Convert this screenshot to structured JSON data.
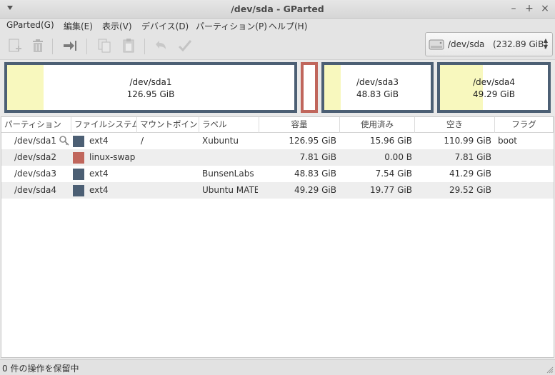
{
  "window": {
    "title": "/dev/sda - GParted"
  },
  "menu": [
    "GParted(G)",
    "編集(E)",
    "表示(V)",
    "デバイス(D)",
    "パーティション(P)",
    "ヘルプ(H)"
  ],
  "device": {
    "name": "/dev/sda",
    "size": "(232.89 GiB)"
  },
  "diskmap": [
    {
      "name": "/dev/sda1",
      "size": "126.95 GiB",
      "used_fraction": 0.126
    },
    {
      "name": "/dev/sda3",
      "size": "48.83 GiB",
      "used_fraction": 0.154
    },
    {
      "name": "/dev/sda4",
      "size": "49.29 GiB",
      "used_fraction": 0.4
    }
  ],
  "columns": [
    "パーティション",
    "ファイルシステム",
    "マウントポイント",
    "ラベル",
    "容量",
    "使用済み",
    "空き",
    "フラグ"
  ],
  "rows": [
    {
      "partition": "/dev/sda1",
      "fs": "ext4",
      "fs_color": "#4c5f74",
      "mount": "/",
      "label": "Xubuntu",
      "size": "126.95 GiB",
      "used": "15.96 GiB",
      "free": "110.99 GiB",
      "flags": "boot",
      "mounted": true
    },
    {
      "partition": "/dev/sda2",
      "fs": "linux-swap",
      "fs_color": "#c0665c",
      "mount": "",
      "label": "",
      "size": "7.81 GiB",
      "used": "0.00 B",
      "free": "7.81 GiB",
      "flags": "",
      "mounted": false
    },
    {
      "partition": "/dev/sda3",
      "fs": "ext4",
      "fs_color": "#4c5f74",
      "mount": "",
      "label": "BunsenLabs",
      "size": "48.83 GiB",
      "used": "7.54 GiB",
      "free": "41.29 GiB",
      "flags": "",
      "mounted": false
    },
    {
      "partition": "/dev/sda4",
      "fs": "ext4",
      "fs_color": "#4c5f74",
      "mount": "",
      "label": "Ubuntu MATE",
      "size": "49.29 GiB",
      "used": "19.77 GiB",
      "free": "29.52 GiB",
      "flags": "",
      "mounted": false
    }
  ],
  "status": "0 件の操作を保留中",
  "colors": {
    "ext4": "#4c5f74",
    "swap": "#c0665c",
    "used": "#f8f8be"
  },
  "icons": [
    "new-partition-icon",
    "delete-icon",
    "resize-icon",
    "copy-icon",
    "paste-icon",
    "undo-icon",
    "apply-icon",
    "harddisk-icon",
    "key-icon"
  ]
}
